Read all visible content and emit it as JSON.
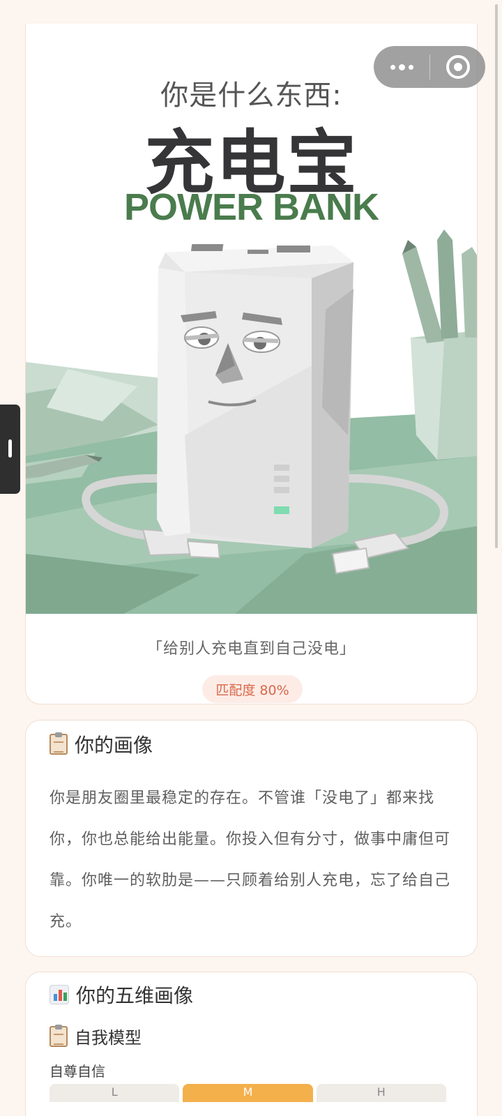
{
  "capsule": {
    "more_icon": "more-dots-icon",
    "close_icon": "target-circle-icon"
  },
  "result": {
    "pre_title": "你是什么东西:",
    "title": "充电宝",
    "title_en": "POWER BANK",
    "quote": "「给别人充电直到自己没电」",
    "match_label": "匹配度 80%",
    "match_value": 0.8
  },
  "portrait": {
    "heading": "你的画像",
    "icon": "clipboard-icon",
    "text": "你是朋友圈里最稳定的存在。不管谁「没电了」都来找你，你也总能给出能量。你投入但有分寸，做事中庸但可靠。你唯一的软肋是——只顾着给别人充电，忘了给自己充。"
  },
  "five_dim": {
    "heading": "你的五维画像",
    "icon": "bar-chart-icon",
    "sub_heading": "自我模型",
    "sub_icon": "clipboard-icon",
    "dimension_label": "自尊自信",
    "levels": [
      "L",
      "M",
      "H"
    ],
    "selected": "M"
  },
  "colors": {
    "background": "#fdf5ef",
    "accent_green": "#4a7c4d",
    "match_text": "#d8684a",
    "active_segment": "#f4b04b"
  }
}
